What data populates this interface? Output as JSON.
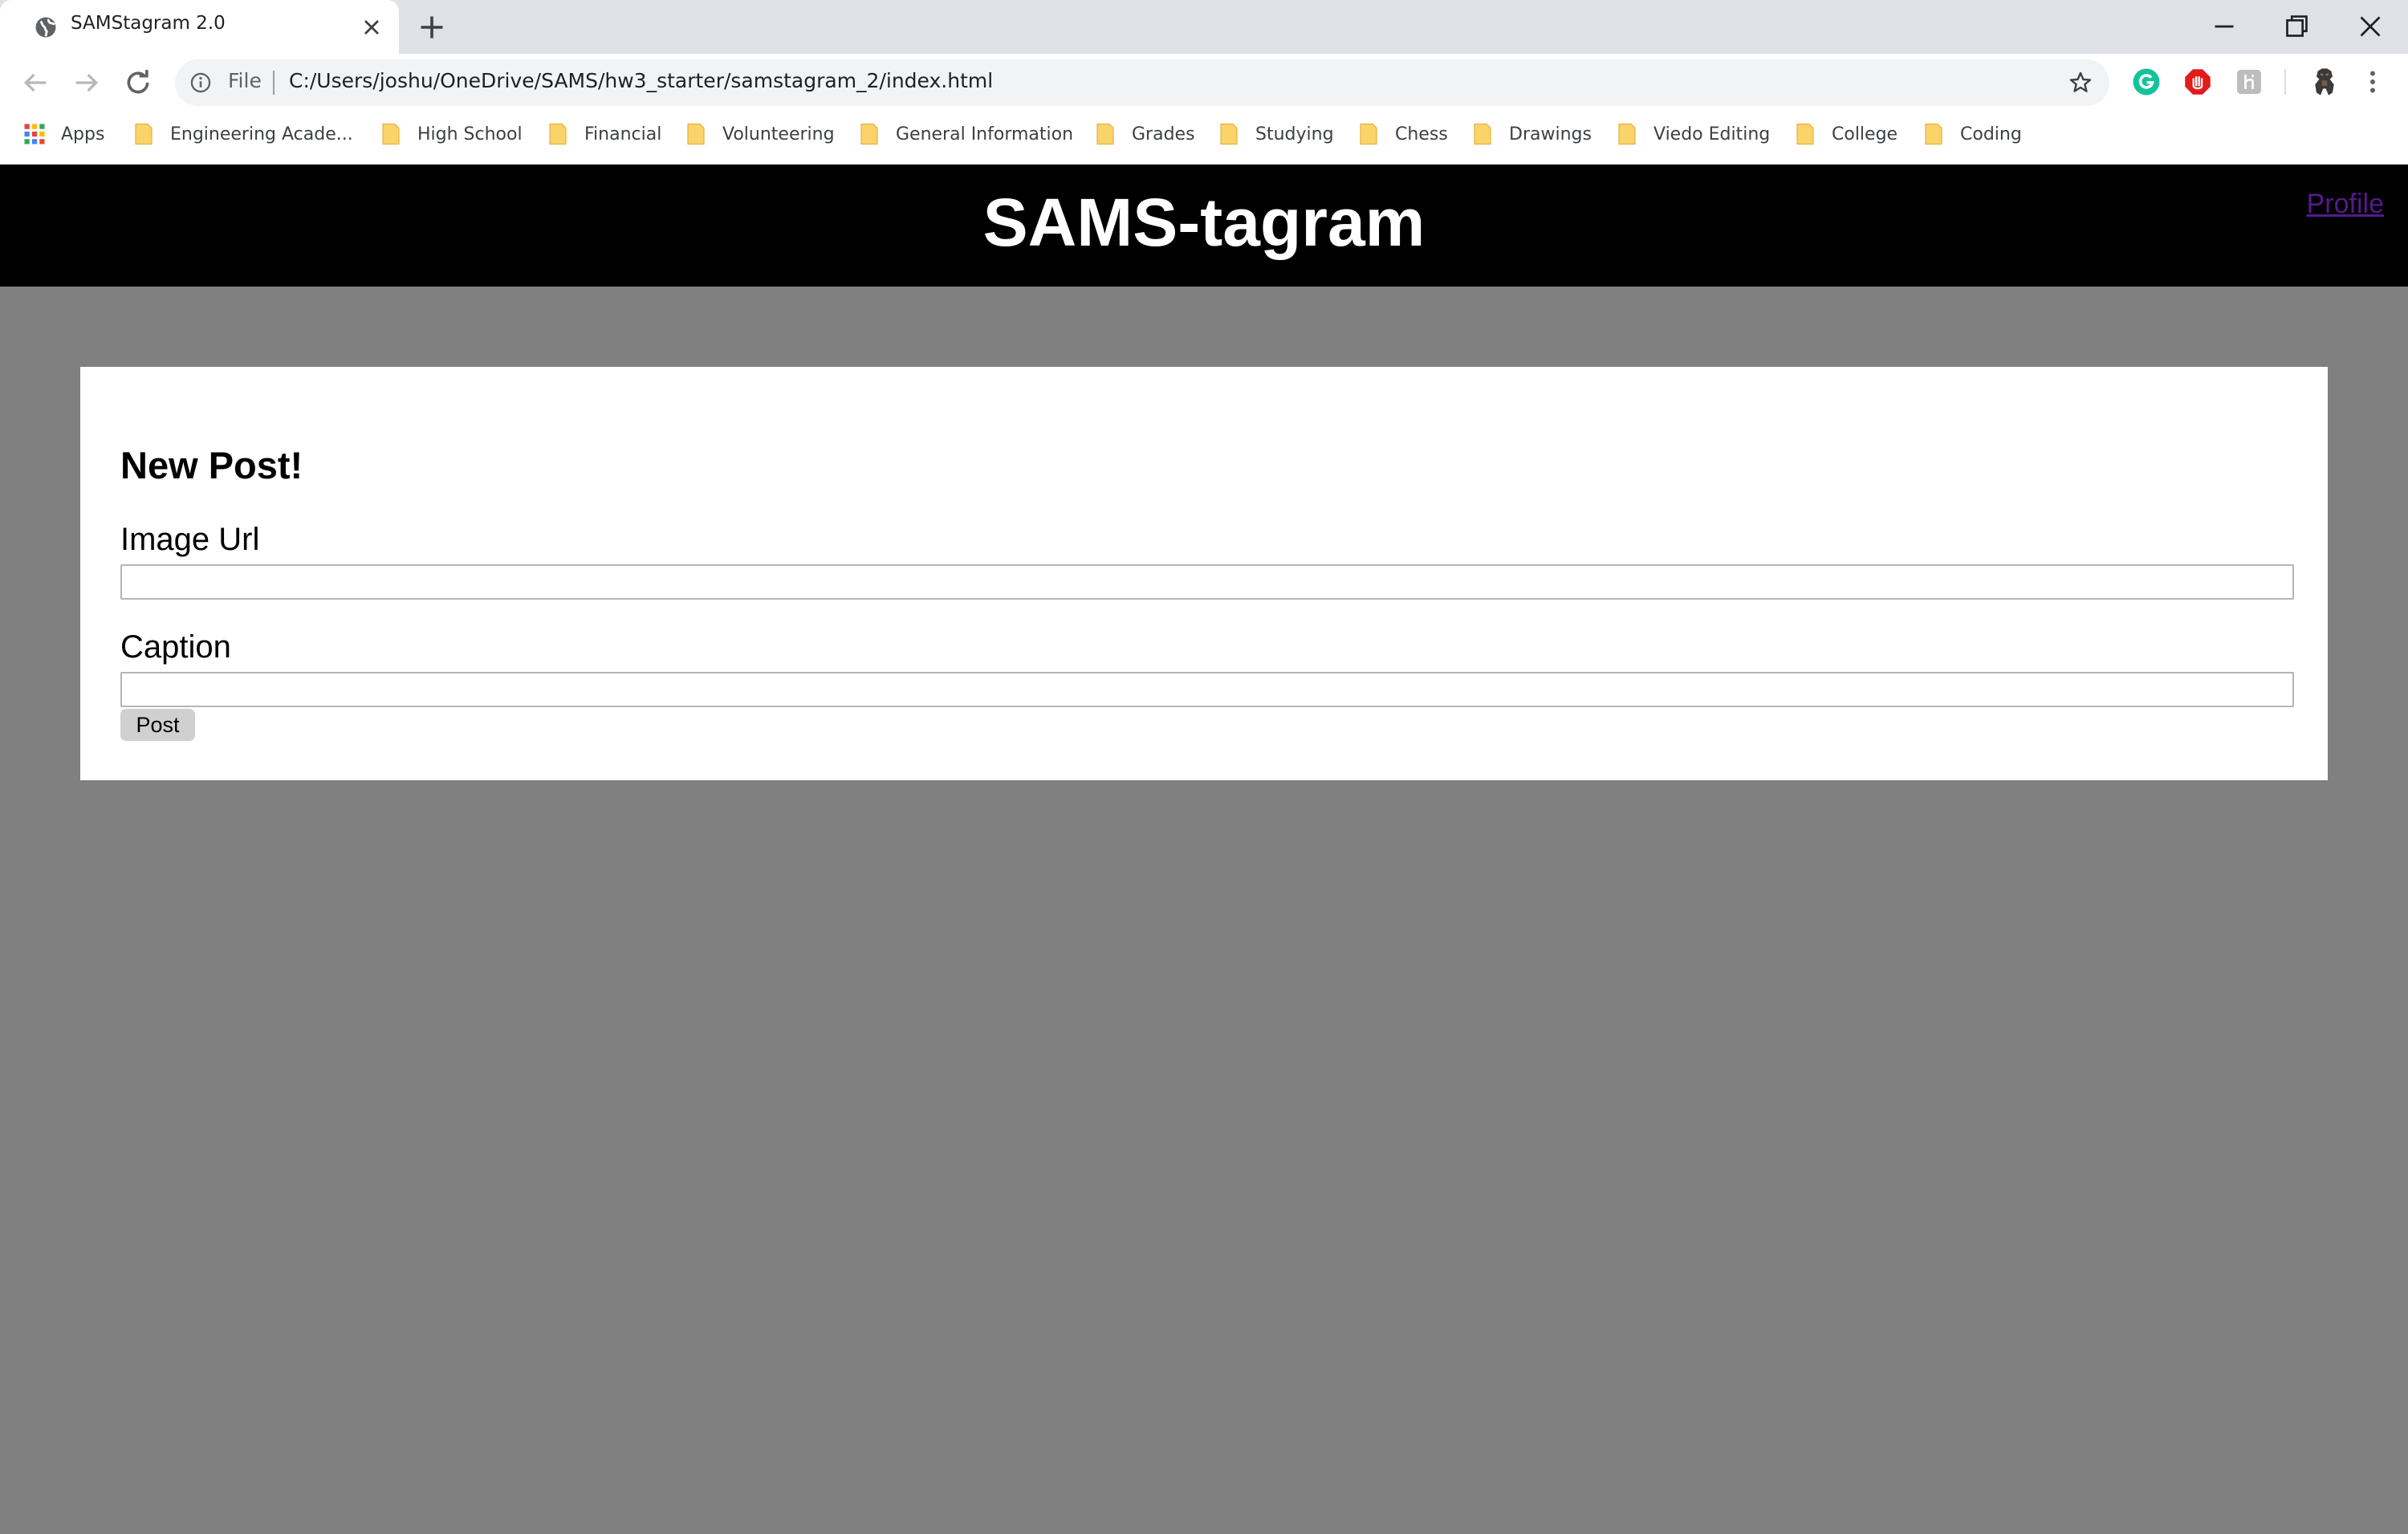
{
  "browser": {
    "tab": {
      "title": "SAMStagram 2.0",
      "favicon": "globe-icon"
    },
    "address_bar": {
      "scheme_label": "File",
      "url": "C:/Users/joshu/OneDrive/SAMS/hw3_starter/samstagram_2/index.html"
    },
    "extensions": [
      "grammarly-icon",
      "adblock-icon",
      "extension-icon",
      "profile-avatar-icon"
    ],
    "bookmarks": [
      "Apps",
      "Engineering Acade...",
      "High School",
      "Financial",
      "Volunteering",
      "General Information",
      "Grades",
      "Studying",
      "Chess",
      "Drawings",
      "Viedo Editing",
      "College",
      "Coding"
    ]
  },
  "site": {
    "title": "SAMS-tagram",
    "profile_link": "Profile"
  },
  "form": {
    "heading": "New Post!",
    "image_url_label": "Image Url",
    "image_url_value": "",
    "caption_label": "Caption",
    "caption_value": "",
    "submit_label": "Post"
  },
  "colors": {
    "header_bg": "#000000",
    "page_bg": "#808080",
    "card_bg": "#ffffff",
    "link_visited": "#551a8b"
  }
}
